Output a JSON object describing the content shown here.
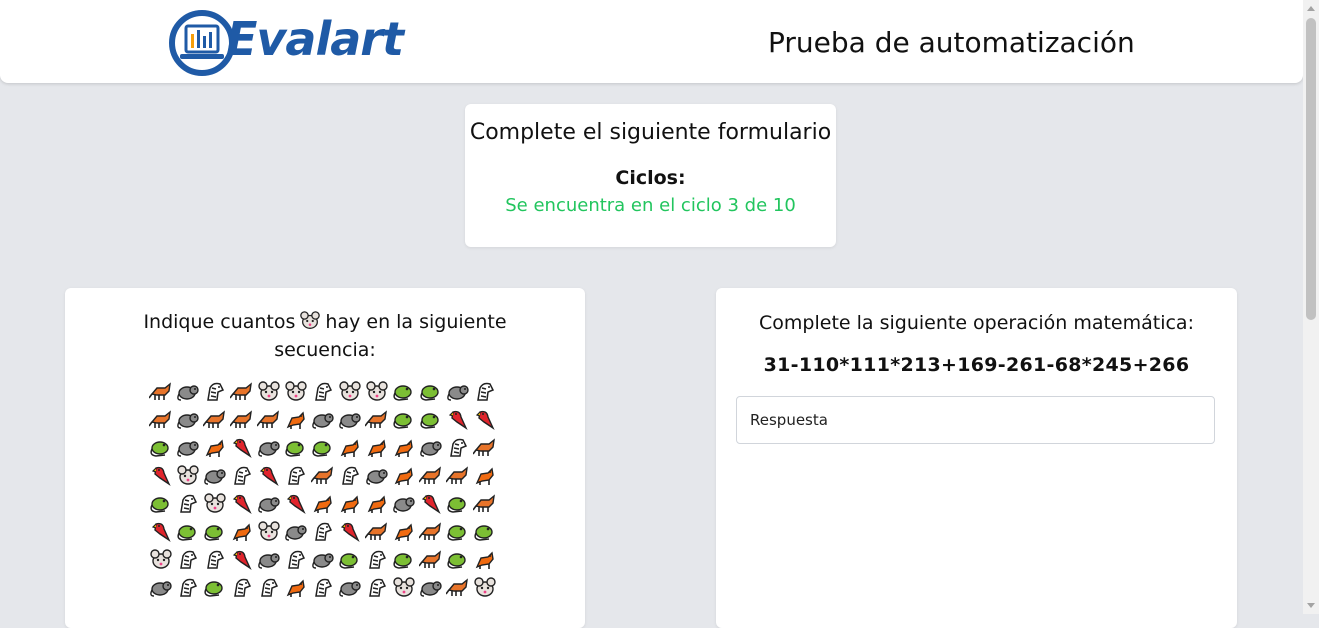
{
  "header": {
    "logo_text": "Evalart",
    "title": "Prueba de automatización"
  },
  "status_card": {
    "title": "Complete el siguiente formulario",
    "cycles_label": "Ciclos:",
    "cycles_value": "Se encuentra en el ciclo 3 de 10"
  },
  "counting_card": {
    "question_before": "Indique cuantos",
    "target_icon": "mouse-icon",
    "question_after": "hay en la siguiente secuencia:",
    "sequence": [
      "fox",
      "rat",
      "zebra",
      "fox",
      "mouse",
      "mouse",
      "zebra",
      "mouse",
      "mouse",
      "lizard",
      "lizard",
      "rat",
      "zebra",
      "fox",
      "rat",
      "fox",
      "fox",
      "fox",
      "squirrel",
      "rat",
      "rat",
      "fox",
      "lizard",
      "lizard",
      "parrot",
      "parrot",
      "lizard",
      "rat",
      "squirrel",
      "parrot",
      "rat",
      "lizard",
      "lizard",
      "squirrel",
      "squirrel",
      "squirrel",
      "rat",
      "zebra",
      "fox",
      "parrot",
      "mouse",
      "rat",
      "zebra",
      "parrot",
      "zebra",
      "fox",
      "zebra",
      "rat",
      "squirrel",
      "fox",
      "fox",
      "squirrel",
      "lizard",
      "zebra",
      "mouse",
      "parrot",
      "rat",
      "parrot",
      "squirrel",
      "squirrel",
      "squirrel",
      "rat",
      "parrot",
      "lizard",
      "fox",
      "parrot",
      "lizard",
      "lizard",
      "squirrel",
      "mouse",
      "rat",
      "zebra",
      "parrot",
      "fox",
      "squirrel",
      "fox",
      "lizard",
      "lizard",
      "mouse",
      "zebra",
      "zebra",
      "parrot",
      "rat",
      "zebra",
      "rat",
      "lizard",
      "zebra",
      "lizard",
      "fox",
      "lizard",
      "squirrel",
      "rat",
      "zebra",
      "lizard",
      "zebra",
      "zebra",
      "squirrel",
      "zebra",
      "rat",
      "zebra",
      "mouse",
      "rat",
      "fox",
      "mouse"
    ]
  },
  "math_card": {
    "question": "Complete la siguiente operación matemática:",
    "operation": "31-110*111*213+169-261-68*245+266",
    "answer_placeholder": "Respuesta"
  },
  "colors": {
    "accent_green": "#22c55e",
    "logo_blue": "#1f5aa6",
    "background": "#e5e7eb"
  }
}
